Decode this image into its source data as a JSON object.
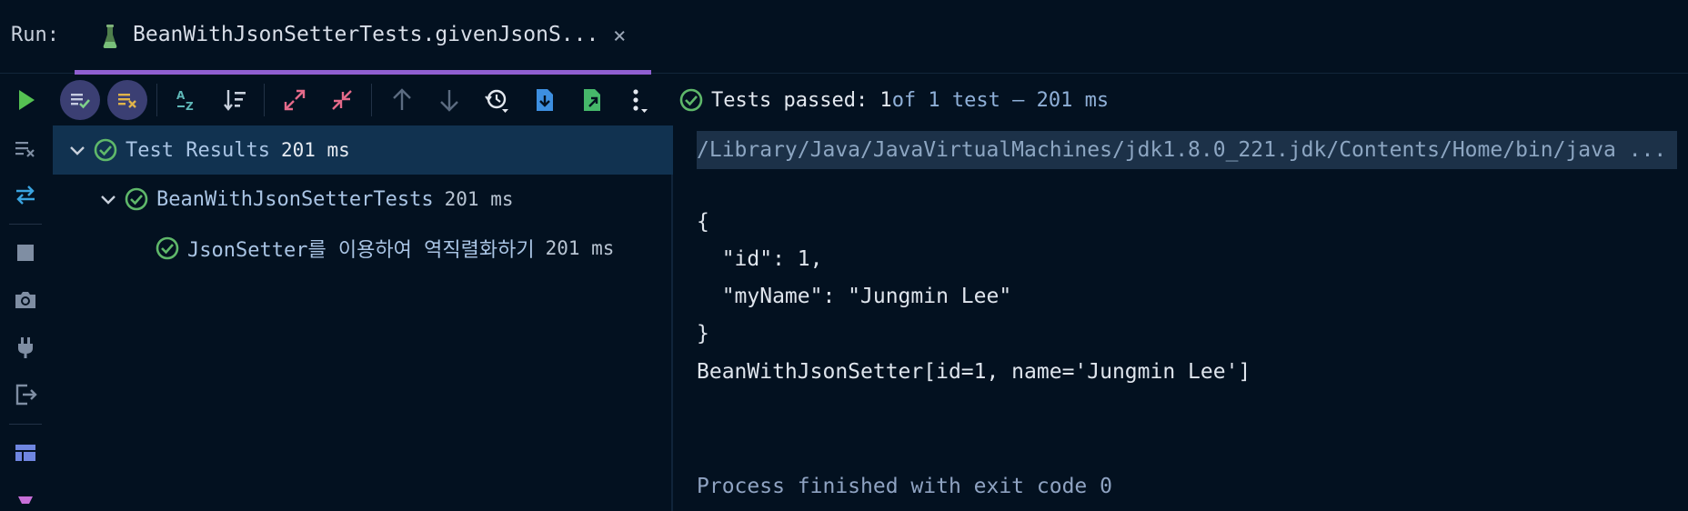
{
  "header": {
    "run_label": "Run:",
    "tab_title": "BeanWithJsonSetterTests.givenJsonS...",
    "tab_close": "×",
    "tab_icon": "flask-icon"
  },
  "toolbar": {
    "status_prefix": "Tests passed: 1",
    "status_suffix": " of 1 test – 201 ms"
  },
  "tree": {
    "items": [
      {
        "label": "Test Results",
        "time": "201 ms",
        "level": 0,
        "expanded": true,
        "selected": true
      },
      {
        "label": "BeanWithJsonSetterTests",
        "time": "201 ms",
        "level": 1,
        "expanded": true,
        "selected": false
      },
      {
        "label": "JsonSetter를 이용하여 역직렬화하기",
        "time": "201 ms",
        "level": 2,
        "expanded": false,
        "selected": false
      }
    ]
  },
  "console": {
    "command": "/Library/Java/JavaVirtualMachines/jdk1.8.0_221.jdk/Contents/Home/bin/java ...",
    "lines": [
      "{",
      "  \"id\": 1,",
      "  \"myName\": \"Jungmin Lee\"",
      "}",
      "BeanWithJsonSetter[id=1, name='Jungmin Lee']"
    ],
    "exit": "Process finished with exit code 0"
  },
  "colors": {
    "background": "#031120",
    "accent_purple": "#8f5fd1",
    "success_green": "#5fb86a",
    "run_green": "#55c152",
    "selected_row": "#113250"
  }
}
